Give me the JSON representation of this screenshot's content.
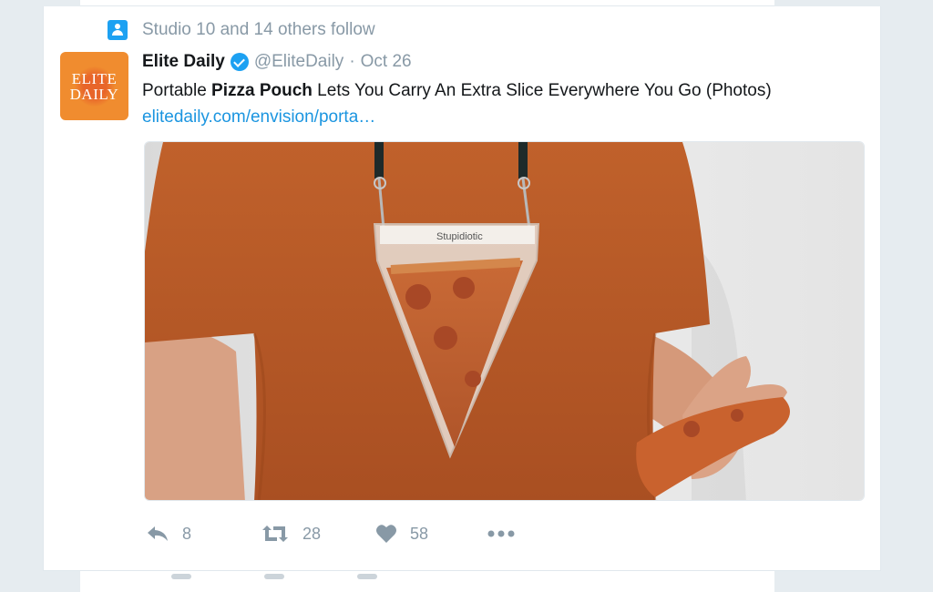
{
  "context": {
    "text": "Studio 10 and 14 others follow",
    "icon": "person-follow-icon"
  },
  "author": {
    "name": "Elite Daily",
    "handle": "@EliteDaily",
    "separator": "·",
    "date": "Oct 26",
    "verified": true,
    "avatar_line1": "ELITE",
    "avatar_line2": "DAILY"
  },
  "tweet": {
    "text_prefix": "Portable ",
    "text_bold": "Pizza Pouch",
    "text_suffix": " Lets You Carry An Extra Slice Everywhere You Go (Photos) ",
    "link": "elitedaily.com/envision/porta…",
    "pouch_label": "Stupidiotic"
  },
  "actions": {
    "reply_count": "8",
    "retweet_count": "28",
    "like_count": "58"
  },
  "colors": {
    "accent": "#1da1f2",
    "link": "#1b95e0",
    "muted": "#8899a6"
  }
}
